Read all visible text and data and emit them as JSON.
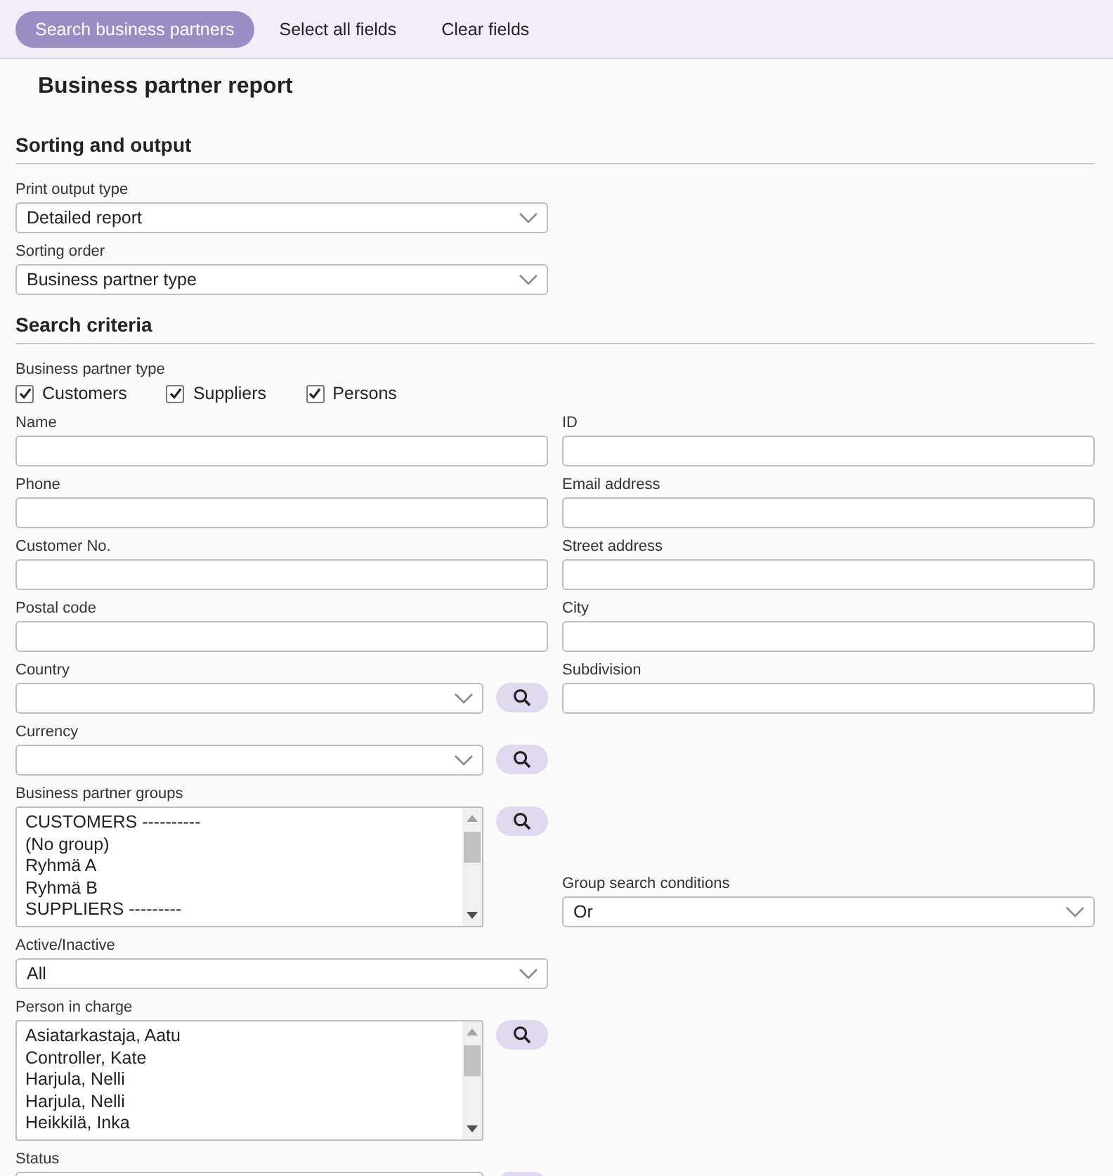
{
  "toolbar": {
    "buttons": [
      {
        "label": "Search business partners",
        "kind": "primary"
      },
      {
        "label": "Select all fields",
        "kind": "plain"
      },
      {
        "label": "Clear fields",
        "kind": "plain"
      }
    ]
  },
  "title": "Business partner report",
  "sections": [
    {
      "heading": "Sorting and output",
      "rows": [
        [
          {
            "kind": "select",
            "label": "Print output type",
            "value": "Detailed report"
          }
        ],
        [
          {
            "kind": "select",
            "label": "Sorting order",
            "value": "Business partner type"
          }
        ]
      ]
    },
    {
      "heading": "Search criteria",
      "rows": [
        [
          {
            "kind": "checkgroup",
            "label": "Business partner type",
            "options": [
              {
                "label": "Customers",
                "checked": true
              },
              {
                "label": "Suppliers",
                "checked": true
              },
              {
                "label": "Persons",
                "checked": true
              }
            ]
          }
        ],
        [
          {
            "kind": "text",
            "label": "Name"
          },
          {
            "kind": "text",
            "label": "ID"
          }
        ],
        [
          {
            "kind": "text",
            "label": "Phone"
          },
          {
            "kind": "text",
            "label": "Email address"
          }
        ],
        [
          {
            "kind": "text",
            "label": "Customer No."
          },
          {
            "kind": "text",
            "label": "Street address"
          }
        ],
        [
          {
            "kind": "text",
            "label": "Postal code"
          },
          {
            "kind": "text",
            "label": "City"
          }
        ],
        [
          {
            "kind": "lookup",
            "label": "Country"
          },
          {
            "kind": "text",
            "label": "Subdivision"
          }
        ],
        [
          {
            "kind": "lookup",
            "label": "Currency"
          }
        ],
        [
          {
            "kind": "listbox",
            "label": "Business partner groups",
            "items": [
              "CUSTOMERS ----------",
              "(No group)",
              "Ryhmä A",
              "Ryhmä B",
              "SUPPLIERS ---------"
            ]
          },
          {
            "kind": "select",
            "label": "Group search conditions",
            "value": "Or"
          }
        ],
        [
          {
            "kind": "select",
            "label": "Active/Inactive",
            "value": "All"
          }
        ],
        [
          {
            "kind": "listbox",
            "label": "Person in charge",
            "items": [
              "Asiatarkastaja, Aatu",
              "Controller, Kate",
              "Harjula, Nelli",
              "Harjula, Nelli",
              "Heikkilä, Inka"
            ]
          }
        ],
        [
          {
            "kind": "lookup",
            "label": "Status"
          }
        ]
      ]
    }
  ]
}
